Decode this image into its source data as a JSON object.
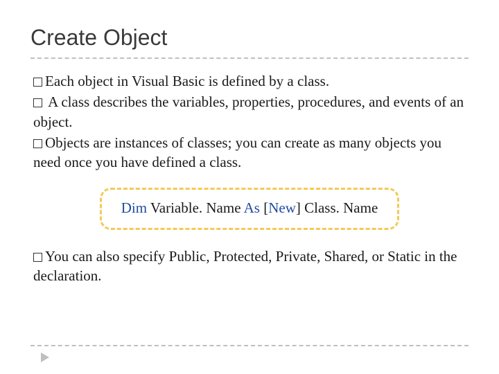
{
  "title": "Create Object",
  "bullets": {
    "b1": "Each object in Visual Basic is defined by a class.",
    "b2": " A class describes the variables, properties, procedures, and events of an object.",
    "b3": "Objects are instances of classes; you can create as many objects you need once you have defined a class.",
    "b4": "You can also specify Public, Protected, Private, Shared, or Static in the declaration."
  },
  "code": {
    "dim": "Dim",
    "var": "Variable. Name",
    "as": "As",
    "open_br": "[",
    "new_kw": "New",
    "close_br": "]",
    "cls": "Class. Name"
  }
}
